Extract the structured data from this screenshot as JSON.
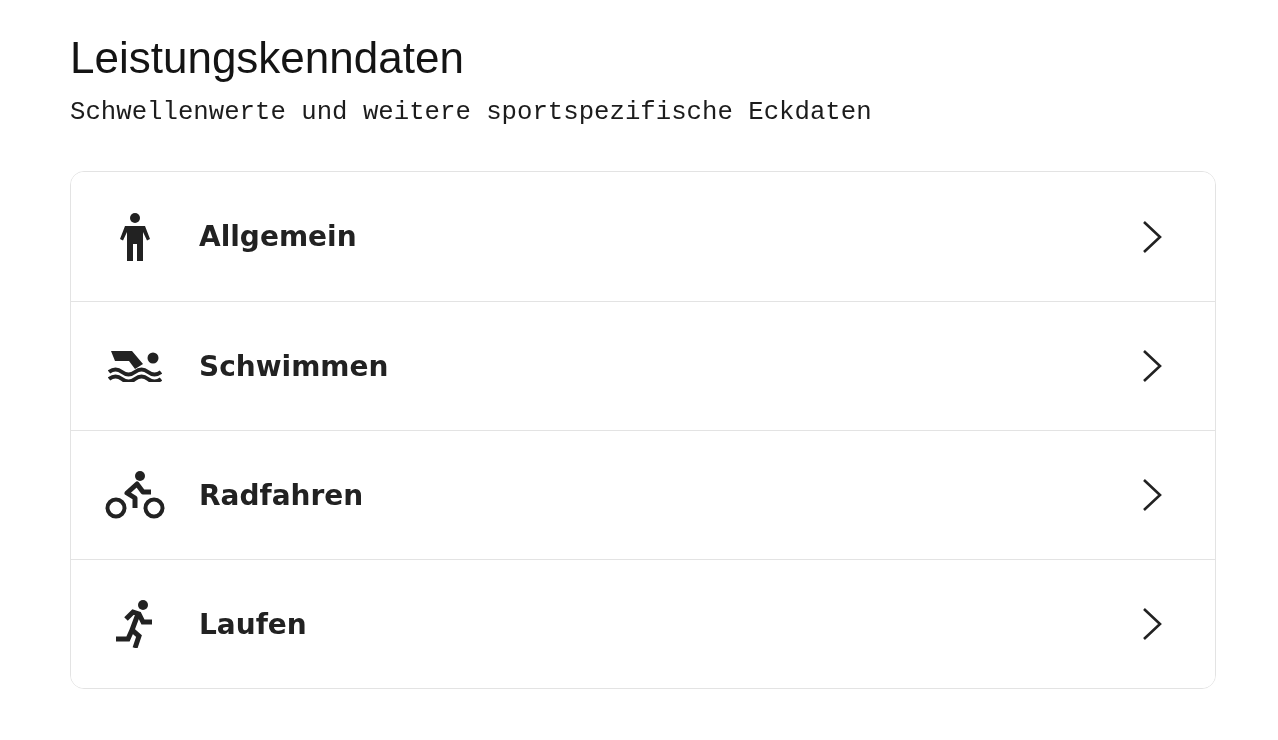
{
  "header": {
    "title": "Leistungskenndaten",
    "subtitle": "Schwellenwerte und weitere sportspezifische Eckdaten"
  },
  "categories": [
    {
      "label": "Allgemein",
      "kind": "general"
    },
    {
      "label": "Schwimmen",
      "kind": "swim"
    },
    {
      "label": "Radfahren",
      "kind": "bike"
    },
    {
      "label": "Laufen",
      "kind": "run"
    }
  ]
}
